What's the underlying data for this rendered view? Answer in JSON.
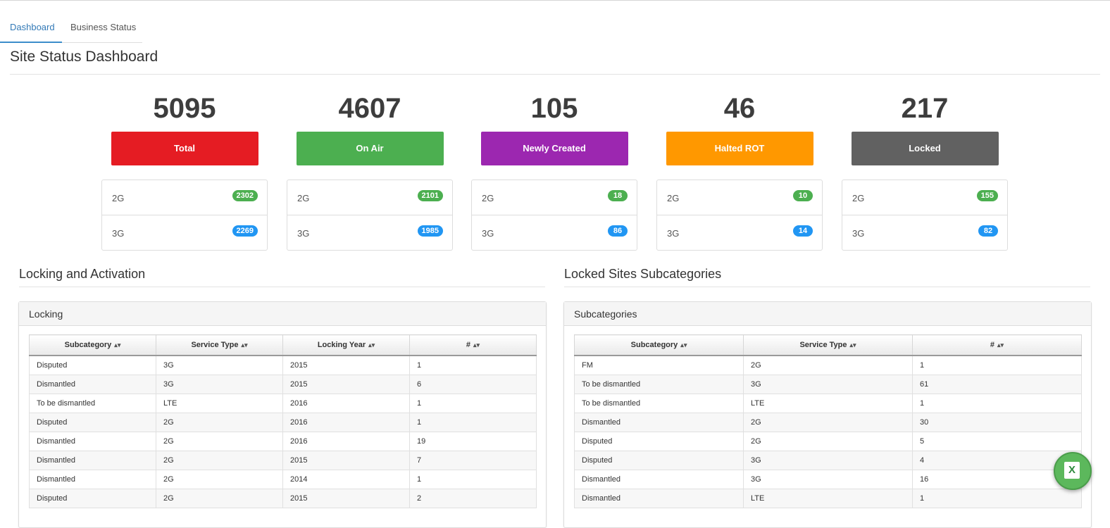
{
  "tabs": [
    {
      "label": "Dashboard",
      "active": true
    },
    {
      "label": "Business Status",
      "active": false
    }
  ],
  "page_title": "Site Status Dashboard",
  "stats": [
    {
      "value": "5095",
      "label": "Total",
      "color": "#e51c23",
      "rows": [
        {
          "tech": "2G",
          "count": "2302"
        },
        {
          "tech": "3G",
          "count": "2269"
        }
      ]
    },
    {
      "value": "4607",
      "label": "On Air",
      "color": "#4caf50",
      "rows": [
        {
          "tech": "2G",
          "count": "2101"
        },
        {
          "tech": "3G",
          "count": "1985"
        }
      ]
    },
    {
      "value": "105",
      "label": "Newly Created",
      "color": "#9c27b0",
      "rows": [
        {
          "tech": "2G",
          "count": "18"
        },
        {
          "tech": "3G",
          "count": "86"
        }
      ]
    },
    {
      "value": "46",
      "label": "Halted ROT",
      "color": "#ff9800",
      "rows": [
        {
          "tech": "2G",
          "count": "10"
        },
        {
          "tech": "3G",
          "count": "14"
        }
      ]
    },
    {
      "value": "217",
      "label": "Locked",
      "color": "#616161",
      "rows": [
        {
          "tech": "2G",
          "count": "155"
        },
        {
          "tech": "3G",
          "count": "82"
        }
      ]
    }
  ],
  "badge_colors": {
    "2G": "#4caf50",
    "3G": "#2196f3"
  },
  "locking_section": {
    "title": "Locking and Activation",
    "panel_title": "Locking",
    "columns": [
      "Subcategory",
      "Service Type",
      "Locking Year",
      "#"
    ],
    "rows": [
      [
        "Disputed",
        "3G",
        "2015",
        "1"
      ],
      [
        "Dismantled",
        "3G",
        "2015",
        "6"
      ],
      [
        "To be dismantled",
        "LTE",
        "2016",
        "1"
      ],
      [
        "Disputed",
        "2G",
        "2016",
        "1"
      ],
      [
        "Dismantled",
        "2G",
        "2016",
        "19"
      ],
      [
        "Dismantled",
        "2G",
        "2015",
        "7"
      ],
      [
        "Dismantled",
        "2G",
        "2014",
        "1"
      ],
      [
        "Disputed",
        "2G",
        "2015",
        "2"
      ]
    ]
  },
  "locked_section": {
    "title": "Locked Sites Subcategories",
    "panel_title": "Subcategories",
    "columns": [
      "Subcategory",
      "Service Type",
      "#"
    ],
    "rows": [
      [
        "FM",
        "2G",
        "1"
      ],
      [
        "To be dismantled",
        "3G",
        "61"
      ],
      [
        "To be dismantled",
        "LTE",
        "1"
      ],
      [
        "Dismantled",
        "2G",
        "30"
      ],
      [
        "Disputed",
        "2G",
        "5"
      ],
      [
        "Disputed",
        "3G",
        "4"
      ],
      [
        "Dismantled",
        "3G",
        "16"
      ],
      [
        "Dismantled",
        "LTE",
        "1"
      ]
    ]
  },
  "excel_button": {
    "icon": "excel-icon",
    "glyph": "X"
  }
}
